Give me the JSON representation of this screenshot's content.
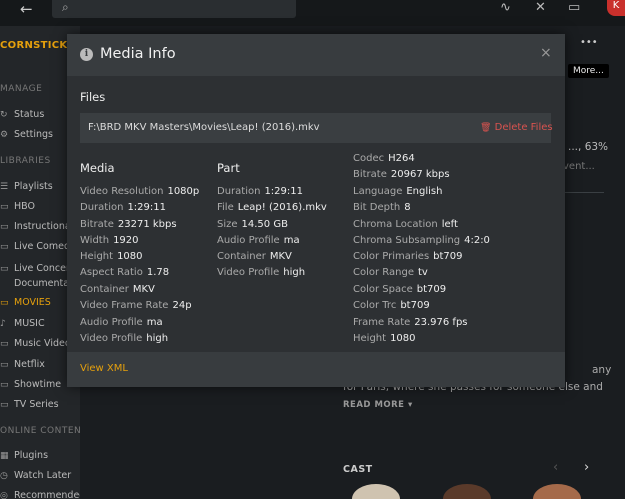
{
  "topbar": {
    "back_icon": "←",
    "search_icon": "⌕",
    "activity_icon": "∿",
    "tools_icon": "✕",
    "cast_icon": "▭",
    "avatar_letter": "K"
  },
  "sidebar": {
    "server_name": "CORNSTICKPL",
    "manage_header": "MANAGE",
    "manage_items": [
      {
        "icon": "↻",
        "label": "Status"
      },
      {
        "icon": "⚙",
        "label": "Settings"
      }
    ],
    "libraries_header": "LIBRARIES",
    "library_items": [
      {
        "icon": "☰",
        "label": "Playlists"
      },
      {
        "icon": "▭",
        "label": "HBO"
      },
      {
        "icon": "▭",
        "label": "Instructional"
      },
      {
        "icon": "▭",
        "label": "Live Comedy"
      },
      {
        "icon": "▭",
        "label": "Live Concerts"
      },
      {
        "icon": "",
        "label": "Documentaries"
      },
      {
        "icon": "▭",
        "label": "MOVIES"
      },
      {
        "icon": "♪",
        "label": "MUSIC"
      },
      {
        "icon": "▭",
        "label": "Music Videos"
      },
      {
        "icon": "▭",
        "label": "Netflix"
      },
      {
        "icon": "▭",
        "label": "Showtime"
      },
      {
        "icon": "▭",
        "label": "TV Series"
      }
    ],
    "online_header": "ONLINE CONTENT",
    "online_items": [
      {
        "icon": "▦",
        "label": "Plugins"
      },
      {
        "icon": "◷",
        "label": "Watch Later"
      },
      {
        "icon": "◎",
        "label": "Recommended"
      }
    ]
  },
  "background": {
    "more_dots": "•••",
    "tooltip": "More...",
    "percent": "..., 63%",
    "event": "vent...",
    "synopsis_end": "any",
    "synopsis_line": "for Paris, where she passes for someone else and",
    "read_more": "READ MORE ▾",
    "cast_label": "CAST",
    "prev_arrow": "‹",
    "next_arrow": "›"
  },
  "modal": {
    "info_icon": "i",
    "title": "Media Info",
    "close_icon": "×",
    "files_label": "Files",
    "file_path": "F:\\BRD MKV Masters\\Movies\\Leap! (2016).mkv",
    "delete_label": "Delete Files",
    "trash_icon": "🗑",
    "media_header": "Media",
    "part_header": "Part",
    "media_rows": [
      {
        "label": "Video Resolution",
        "value": "1080p"
      },
      {
        "label": "Duration",
        "value": "1:29:11"
      },
      {
        "label": "Bitrate",
        "value": "23271 kbps"
      },
      {
        "label": "Width",
        "value": "1920"
      },
      {
        "label": "Height",
        "value": "1080"
      },
      {
        "label": "Aspect Ratio",
        "value": "1.78"
      },
      {
        "label": "Container",
        "value": "MKV"
      },
      {
        "label": "Video Frame Rate",
        "value": "24p"
      },
      {
        "label": "Audio Profile",
        "value": "ma"
      },
      {
        "label": "Video Profile",
        "value": "high"
      }
    ],
    "part_rows": [
      {
        "label": "Duration",
        "value": "1:29:11"
      },
      {
        "label": "File",
        "value": "Leap! (2016).mkv"
      },
      {
        "label": "Size",
        "value": "14.50 GB"
      },
      {
        "label": "Audio Profile",
        "value": "ma"
      },
      {
        "label": "Container",
        "value": "MKV"
      },
      {
        "label": "Video Profile",
        "value": "high"
      }
    ],
    "stream_rows": [
      {
        "label": "Codec",
        "value": "H264"
      },
      {
        "label": "Bitrate",
        "value": "20967 kbps"
      },
      {
        "label": "Language",
        "value": "English"
      },
      {
        "label": "Bit Depth",
        "value": "8"
      },
      {
        "label": "Chroma Location",
        "value": "left"
      },
      {
        "label": "Chroma Subsampling",
        "value": "4:2:0"
      },
      {
        "label": "Color Primaries",
        "value": "bt709"
      },
      {
        "label": "Color Range",
        "value": "tv"
      },
      {
        "label": "Color Space",
        "value": "bt709"
      },
      {
        "label": "Color Trc",
        "value": "bt709"
      },
      {
        "label": "Frame Rate",
        "value": "23.976 fps"
      },
      {
        "label": "Height",
        "value": "1080"
      }
    ],
    "view_xml": "View XML"
  },
  "colors": {
    "accent": "#e5a00d",
    "danger": "#d9534f",
    "modal_bg": "#2d3033",
    "header_bg": "#383c3f"
  }
}
